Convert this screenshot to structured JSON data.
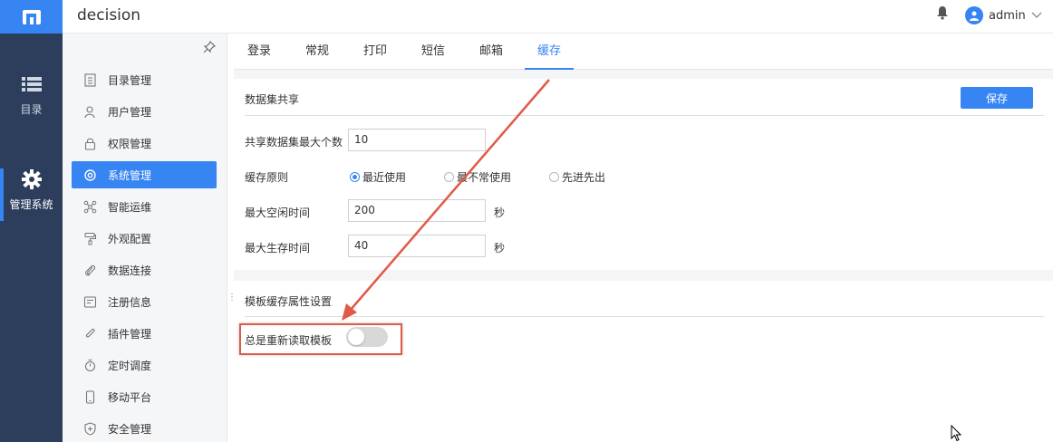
{
  "app": {
    "title": "decision"
  },
  "header": {
    "username": "admin",
    "icons": [
      "bell-icon",
      "user-avatar-icon",
      "chevron-down-icon"
    ]
  },
  "rail": {
    "items": [
      {
        "label": "目录",
        "icon": "list-icon"
      },
      {
        "label": "管理系统",
        "icon": "gear-icon"
      }
    ]
  },
  "menu": {
    "items": [
      {
        "label": "目录管理",
        "icon": "catalog-icon"
      },
      {
        "label": "用户管理",
        "icon": "user-icon"
      },
      {
        "label": "权限管理",
        "icon": "lock-icon"
      },
      {
        "label": "系统管理",
        "icon": "gear-icon"
      },
      {
        "label": "智能运维",
        "icon": "ops-icon"
      },
      {
        "label": "外观配置",
        "icon": "paint-roller-icon"
      },
      {
        "label": "数据连接",
        "icon": "paperclip-icon"
      },
      {
        "label": "注册信息",
        "icon": "register-icon"
      },
      {
        "label": "插件管理",
        "icon": "plugin-icon"
      },
      {
        "label": "定时调度",
        "icon": "timer-icon"
      },
      {
        "label": "移动平台",
        "icon": "mobile-icon"
      },
      {
        "label": "安全管理",
        "icon": "shield-icon"
      }
    ],
    "active_index": 3
  },
  "tabs": [
    {
      "label": "登录"
    },
    {
      "label": "常规"
    },
    {
      "label": "打印"
    },
    {
      "label": "短信"
    },
    {
      "label": "邮箱"
    },
    {
      "label": "缓存"
    }
  ],
  "active_tab": "缓存",
  "dataset_share": {
    "title": "数据集共享",
    "save_label": "保存",
    "max_count_label": "共享数据集最大个数",
    "max_count_value": "10",
    "cache_policy_label": "缓存原则",
    "cache_policy_options": [
      "最近使用",
      "最不常使用",
      "先进先出"
    ],
    "cache_policy_selected": "最近使用",
    "max_idle_label": "最大空闲时间",
    "max_idle_value": "200",
    "max_idle_unit": "秒",
    "max_live_label": "最大生存时间",
    "max_live_value": "40",
    "max_live_unit": "秒"
  },
  "template_cache": {
    "title": "模板缓存属性设置",
    "always_reload_label": "总是重新读取模板",
    "always_reload_enabled": false
  },
  "colors": {
    "accent": "#3685f2",
    "rail": "#2c3e5c",
    "annotation": "#e05a47"
  }
}
